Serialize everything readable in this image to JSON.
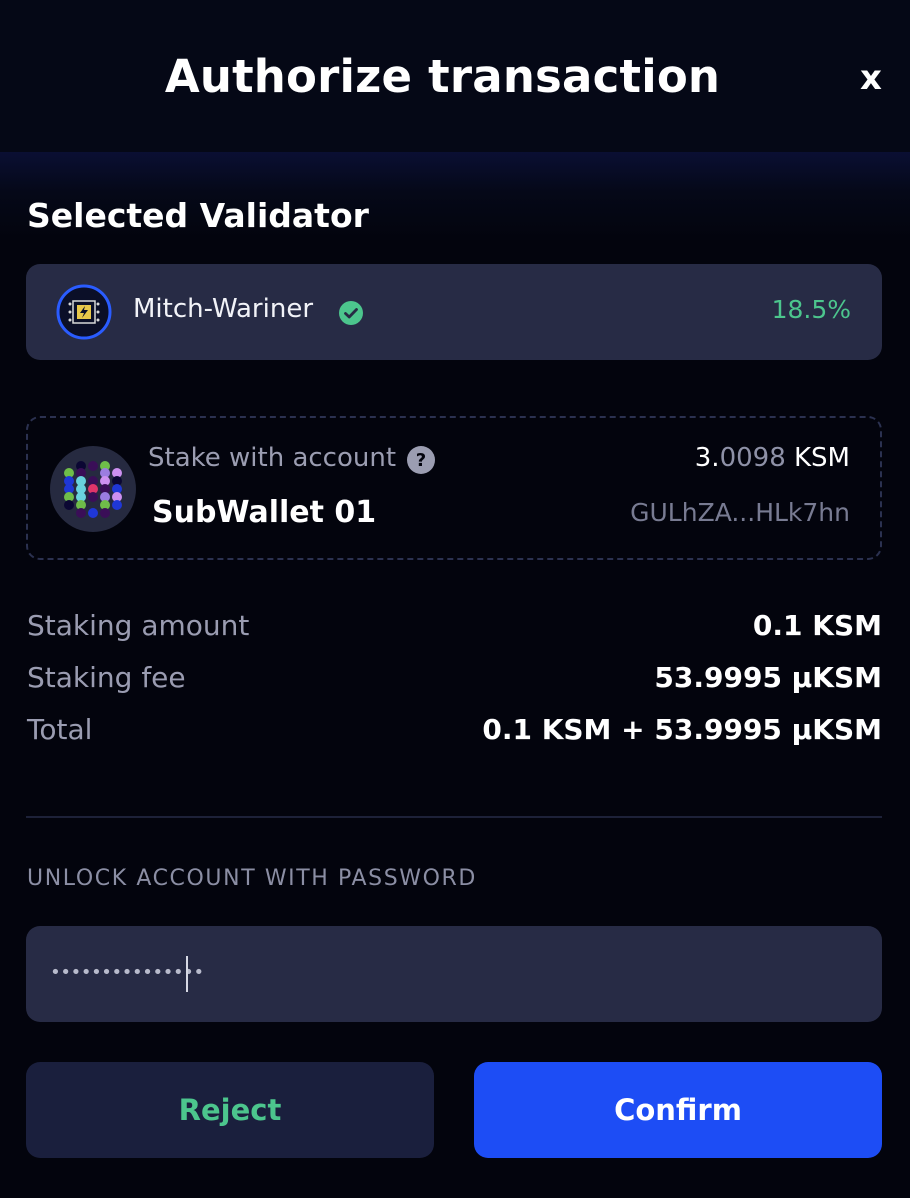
{
  "header": {
    "title": "Authorize transaction",
    "close_label": "x"
  },
  "validator_section": {
    "title": "Selected Validator",
    "name": "Mitch-Wariner",
    "verified_icon": "check-circle-icon",
    "rate": "18.5%"
  },
  "account": {
    "stake_label": "Stake with account",
    "help_icon": "question-circle-icon",
    "name": "SubWallet 01",
    "balance_integer": "3.",
    "balance_fraction": "0098",
    "balance_unit": " KSM",
    "address": "GULhZA...HLk7hn"
  },
  "summary": {
    "rows": [
      {
        "label": "Staking amount",
        "value": "0.1 KSM"
      },
      {
        "label": "Staking fee",
        "value": "53.9995 µKSM"
      },
      {
        "label": "Total",
        "value": "0.1 KSM + 53.9995 µKSM"
      }
    ]
  },
  "password": {
    "label": "UNLOCK ACCOUNT WITH PASSWORD",
    "masked_value": "•••••••••••••••"
  },
  "actions": {
    "reject_label": "Reject",
    "confirm_label": "Confirm"
  },
  "colors": {
    "background": "#03040d",
    "card": "#272b45",
    "accent_blue": "#1d4df5",
    "accent_green": "#4cc58d"
  }
}
